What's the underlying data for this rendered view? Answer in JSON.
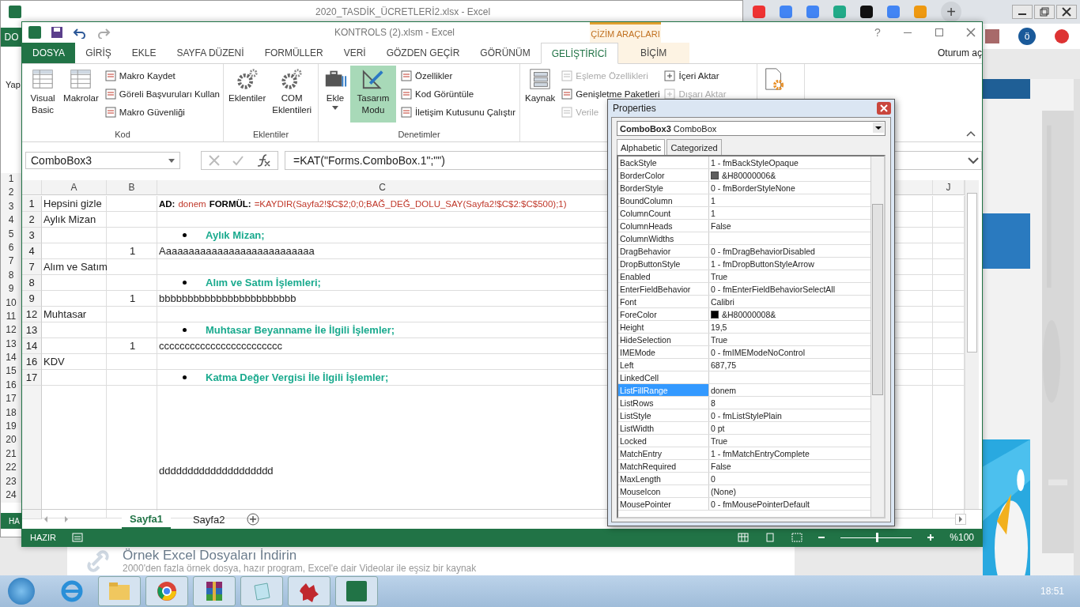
{
  "back_window": {
    "title": "2020_TASDİK_ÜCRETLERİ2.xlsx - Excel",
    "file_tab": "DO",
    "ribbon_fragment": "Yap",
    "status_fragment": "HA",
    "row_numbers": [
      "1",
      "2",
      "3",
      "4",
      "5",
      "6",
      "7",
      "8",
      "9",
      "10",
      "11",
      "12",
      "13",
      "14",
      "15",
      "16",
      "17",
      "18",
      "19",
      "20",
      "21",
      "22",
      "23",
      "24"
    ]
  },
  "browser": {
    "new_tab": "+",
    "page_title": "Örnek Excel Dosyaları İndirin",
    "page_subtitle": "2000'den fazla örnek dosya, hazır program, Excel'e dair Videolar ile eşsiz bir kaynak",
    "avatar": "ö"
  },
  "window": {
    "title": "KONTROLS (2).xlsm - Excel",
    "help": "?",
    "sign_in": "Oturum aç",
    "context_header": "ÇİZİM ARAÇLARI"
  },
  "tabs": [
    {
      "label": "DOSYA",
      "kind": "file",
      "selected": false
    },
    {
      "label": "GİRİŞ",
      "kind": "tab",
      "selected": false
    },
    {
      "label": "EKLE",
      "kind": "tab",
      "selected": false
    },
    {
      "label": "SAYFA DÜZENİ",
      "kind": "tab",
      "selected": false
    },
    {
      "label": "FORMÜLLER",
      "kind": "tab",
      "selected": false
    },
    {
      "label": "VERİ",
      "kind": "tab",
      "selected": false
    },
    {
      "label": "GÖZDEN GEÇİR",
      "kind": "tab",
      "selected": false
    },
    {
      "label": "GÖRÜNÜM",
      "kind": "tab",
      "selected": false
    },
    {
      "label": "GELİŞTİRİCİ",
      "kind": "tab",
      "selected": true
    },
    {
      "label": "BİÇİM",
      "kind": "context",
      "selected": false
    }
  ],
  "ribbon": {
    "groups": [
      {
        "label": "Kod",
        "large": [
          {
            "label": "Visual Basic",
            "on": false,
            "dropdown": false
          },
          {
            "label": "Makrolar",
            "on": false,
            "dropdown": false
          }
        ],
        "small": [
          {
            "label": "Makro Kaydet",
            "disabled": false
          },
          {
            "label": "Göreli Başvuruları Kullan",
            "disabled": false
          },
          {
            "label": "Makro Güvenliği",
            "disabled": false
          }
        ]
      },
      {
        "label": "Eklentiler",
        "large": [
          {
            "label": "Eklentiler",
            "on": false,
            "dropdown": false
          },
          {
            "label": "COM Eklentileri",
            "on": false,
            "dropdown": false
          }
        ]
      },
      {
        "label": "Denetimler",
        "large": [
          {
            "label": "Ekle",
            "on": false,
            "dropdown": true
          },
          {
            "label": "Tasarım Modu",
            "on": true,
            "dropdown": false
          }
        ],
        "small": [
          {
            "label": "Özellikler",
            "disabled": false
          },
          {
            "label": "Kod Görüntüle",
            "disabled": false
          },
          {
            "label": "İletişim Kutusunu Çalıştır",
            "disabled": false
          }
        ]
      },
      {
        "large": [
          {
            "label": "Kaynak",
            "on": false,
            "dropdown": false
          }
        ],
        "small": [
          {
            "label": "Eşleme Özellikleri",
            "disabled": true
          },
          {
            "label": "Genişletme Paketleri",
            "disabled": false
          },
          {
            "label": "Verile",
            "disabled": true
          }
        ],
        "small2": [
          {
            "label": "İçeri Aktar",
            "disabled": false
          },
          {
            "label": "Dışarı Aktar",
            "disabled": true
          }
        ]
      },
      {
        "large": [
          {
            "on": false,
            "dropdown": false
          }
        ]
      }
    ]
  },
  "formula_bar": {
    "name_box": "ComboBox3",
    "formula": "=KAT(\"Forms.ComboBox.1\";\"\")"
  },
  "columns": [
    "A",
    "B",
    "C",
    "J"
  ],
  "rows": [
    {
      "num": "1",
      "kind": "note",
      "a": "Hepsini gizle",
      "segments": [
        {
          "text": "AD:",
          "bold": true,
          "color": "#000000"
        },
        {
          "text": "donem",
          "bold": false,
          "color": "#c0392b"
        },
        {
          "text": "FORMÜL:",
          "bold": true,
          "color": "#000000"
        },
        {
          "text": "=KAYDIR(Sayfa2!$C$2;0;0;BAĞ_DEĞ_DOLU_SAY(Sayfa2!$C$2:$C$500);1)",
          "bold": false,
          "color": "#c0392b"
        }
      ]
    },
    {
      "num": "2",
      "kind": "text",
      "a": "Aylık Mizan"
    },
    {
      "num": "3",
      "kind": "bullet",
      "c": "Aylık Mizan;"
    },
    {
      "num": "4",
      "kind": "text",
      "b": "1",
      "c": "Aaaaaaaaaaaaaaaaaaaaaaaaaaa"
    },
    {
      "num": "7",
      "kind": "text",
      "a": "Alım ve Satım"
    },
    {
      "num": "8",
      "kind": "bullet",
      "c": "Alım ve Satım İşlemleri;"
    },
    {
      "num": "9",
      "kind": "text",
      "b": "1",
      "c": "bbbbbbbbbbbbbbbbbbbbbbbb"
    },
    {
      "num": "12",
      "kind": "text",
      "a": "Muhtasar"
    },
    {
      "num": "13",
      "kind": "bullet",
      "c": "Muhtasar Beyanname İle İlgili İşlemler;"
    },
    {
      "num": "14",
      "kind": "text",
      "b": "1",
      "c": "cccccccccccccccccccccccc"
    },
    {
      "num": "16",
      "kind": "text",
      "a": "KDV"
    },
    {
      "num": "17",
      "kind": "bullet",
      "c": "Katma Değer Vergisi İle İlgili İşlemler;"
    },
    {
      "kind": "tall",
      "c": "dddddddddddddddddddd"
    }
  ],
  "sheet_tabs": [
    {
      "label": "Sayfa1",
      "selected": true
    },
    {
      "label": "Sayfa2",
      "selected": false
    }
  ],
  "status_bar": {
    "status": "HAZIR",
    "zoom": "%100",
    "level": 0.5
  },
  "properties": {
    "title": "Properties",
    "object_name": "ComboBox3",
    "object_type": "ComboBox",
    "tabs": [
      {
        "label": "Alphabetic",
        "selected": true
      },
      {
        "label": "Categorized",
        "selected": false
      }
    ],
    "items": [
      {
        "name": "BackStyle",
        "value": "1 - fmBackStyleOpaque",
        "selected": false
      },
      {
        "name": "BorderColor",
        "value": "&H80000006&",
        "color": "#5e5e5e",
        "selected": false
      },
      {
        "name": "BorderStyle",
        "value": "0 - fmBorderStyleNone",
        "selected": false
      },
      {
        "name": "BoundColumn",
        "value": "1",
        "selected": false
      },
      {
        "name": "ColumnCount",
        "value": "1",
        "selected": false
      },
      {
        "name": "ColumnHeads",
        "value": "False",
        "selected": false
      },
      {
        "name": "ColumnWidths",
        "selected": false
      },
      {
        "name": "DragBehavior",
        "value": "0 - fmDragBehaviorDisabled",
        "selected": false
      },
      {
        "name": "DropButtonStyle",
        "value": "1 - fmDropButtonStyleArrow",
        "selected": false
      },
      {
        "name": "Enabled",
        "value": "True",
        "selected": false
      },
      {
        "name": "EnterFieldBehavior",
        "value": "0 - fmEnterFieldBehaviorSelectAll",
        "selected": false
      },
      {
        "name": "Font",
        "value": "Calibri",
        "selected": false
      },
      {
        "name": "ForeColor",
        "value": "&H80000008&",
        "color": "#000000",
        "selected": false
      },
      {
        "name": "Height",
        "value": "19,5",
        "selected": false
      },
      {
        "name": "HideSelection",
        "value": "True",
        "selected": false
      },
      {
        "name": "IMEMode",
        "value": "0 - fmIMEModeNoControl",
        "selected": false
      },
      {
        "name": "Left",
        "value": "687,75",
        "selected": false
      },
      {
        "name": "LinkedCell",
        "selected": false
      },
      {
        "name": "ListFillRange",
        "value": "donem",
        "selected": true
      },
      {
        "name": "ListRows",
        "value": "8",
        "selected": false
      },
      {
        "name": "ListStyle",
        "value": "0 - fmListStylePlain",
        "selected": false
      },
      {
        "name": "ListWidth",
        "value": "0 pt",
        "selected": false
      },
      {
        "name": "Locked",
        "value": "True",
        "selected": false
      },
      {
        "name": "MatchEntry",
        "value": "1 - fmMatchEntryComplete",
        "selected": false
      },
      {
        "name": "MatchRequired",
        "value": "False",
        "selected": false
      },
      {
        "name": "MaxLength",
        "value": "0",
        "selected": false
      },
      {
        "name": "MouseIcon",
        "value": "(None)",
        "selected": false
      },
      {
        "name": "MousePointer",
        "value": "0 - fmMousePointerDefault",
        "selected": false
      }
    ]
  },
  "taskbar": {
    "time": "18:51"
  }
}
